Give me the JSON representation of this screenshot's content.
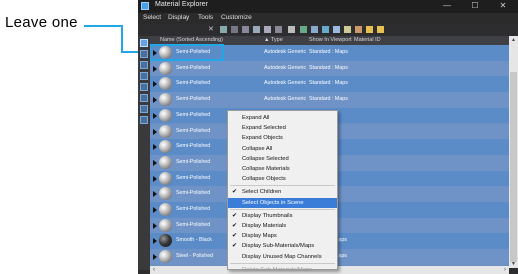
{
  "annotation": {
    "text": "Leave one"
  },
  "window": {
    "title": "Material Explorer",
    "controls": {
      "minimize": "—",
      "maximize": "☐",
      "close": "✕"
    }
  },
  "menu": {
    "items": [
      "Select",
      "Display",
      "Tools",
      "Customize"
    ]
  },
  "columns": {
    "name": "Name (Sorted Ascending)",
    "type": "▲ Type",
    "show_in_viewport": "Show In Viewport",
    "material_id": "Material ID"
  },
  "rows": [
    {
      "name": "Semi-Polished",
      "type": "Autodesk Generic",
      "show": "Standard : Maps",
      "swatch": "white"
    },
    {
      "name": "Semi-Polished",
      "type": "Autodesk Generic",
      "show": "Standard : Maps",
      "swatch": "white"
    },
    {
      "name": "Semi-Polished",
      "type": "Autodesk Generic",
      "show": "Standard : Maps",
      "swatch": "white"
    },
    {
      "name": "Semi-Polished",
      "type": "Autodesk Generic",
      "show": "Standard : Maps",
      "swatch": "white"
    },
    {
      "name": "Semi-Polished",
      "type": "",
      "show": "",
      "swatch": "white"
    },
    {
      "name": "Semi-Polished",
      "type": "",
      "show": "",
      "swatch": "white"
    },
    {
      "name": "Semi-Polished",
      "type": "",
      "show": "",
      "swatch": "white"
    },
    {
      "name": "Semi-Polished",
      "type": "",
      "show": "",
      "swatch": "white"
    },
    {
      "name": "Semi-Polished",
      "type": "",
      "show": "",
      "swatch": "white"
    },
    {
      "name": "Semi-Polished",
      "type": "",
      "show": "",
      "swatch": "white"
    },
    {
      "name": "Semi-Polished",
      "type": "",
      "show": "",
      "swatch": "white"
    },
    {
      "name": "Semi-Polished",
      "type": "",
      "show": "",
      "swatch": "white"
    },
    {
      "name": "Smooth - Black",
      "type": "",
      "show": "Maps",
      "swatch": "black"
    },
    {
      "name": "Steel - Polished",
      "type": "",
      "show": "Maps",
      "swatch": "white"
    }
  ],
  "context_menu": {
    "items": [
      {
        "label": "Expand All",
        "checked": false
      },
      {
        "label": "Expand Selected",
        "checked": false
      },
      {
        "label": "Expand Objects",
        "checked": false
      },
      {
        "label": "Collapse All",
        "checked": false
      },
      {
        "label": "Collapse Selected",
        "checked": false
      },
      {
        "label": "Collapse Materials",
        "checked": false
      },
      {
        "label": "Collapse Objects",
        "checked": false
      },
      {
        "label": "Select Children",
        "checked": true
      },
      {
        "label": "Select Objects in Scene",
        "checked": false,
        "highlighted": true
      },
      {
        "label": "Display Thumbnails",
        "checked": true
      },
      {
        "label": "Display Materials",
        "checked": true
      },
      {
        "label": "Display Maps",
        "checked": true
      },
      {
        "label": "Display Sub-Materials/Maps",
        "checked": true
      },
      {
        "label": "Display Unused Map Channels",
        "checked": false
      },
      {
        "label": "Delete Sub-Materials/Maps",
        "checked": false,
        "disabled": true
      }
    ],
    "check_glyph": "✔"
  },
  "colors": {
    "accent": "#22a7e6",
    "row_selected": "#5b8cc8",
    "menu_highlight": "#3a7dd8"
  }
}
